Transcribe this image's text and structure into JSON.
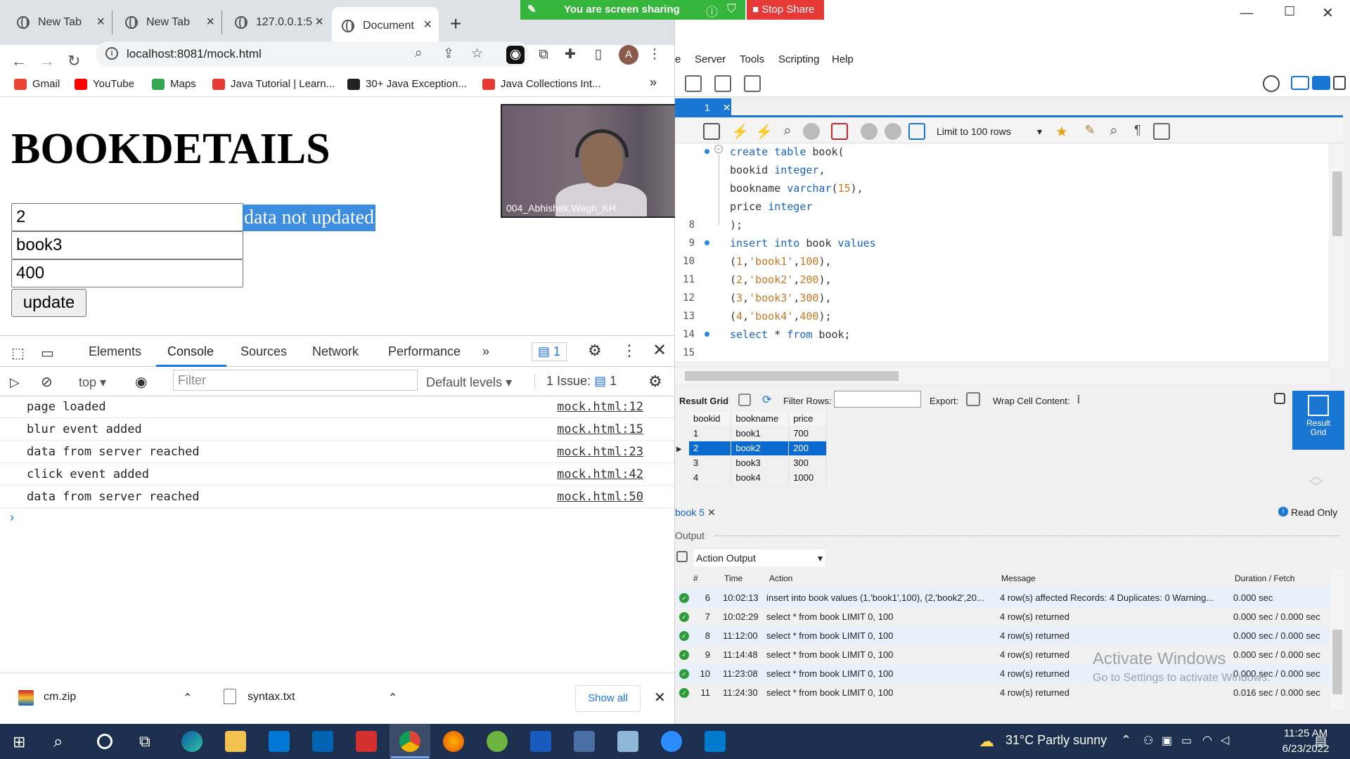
{
  "browser": {
    "tabs": [
      {
        "title": "New Tab"
      },
      {
        "title": "New Tab"
      },
      {
        "title": "127.0.0.1:5"
      },
      {
        "title": "Document"
      }
    ],
    "url": "localhost:8081/mock.html",
    "avatar_letter": "A",
    "bookmarks": [
      {
        "label": "Gmail",
        "color": "#ea4335"
      },
      {
        "label": "YouTube",
        "color": "#ff0000"
      },
      {
        "label": "Maps",
        "color": "#34a853"
      },
      {
        "label": "Java Tutorial | Learn...",
        "color": "#e53935"
      },
      {
        "label": "30+ Java Exception...",
        "color": "#222222"
      },
      {
        "label": "Java Collections Int...",
        "color": "#e53935"
      }
    ],
    "more_bookmarks": "»"
  },
  "page": {
    "heading": "BOOKDETAILS",
    "field_id": "2",
    "field_name": "book3",
    "field_price": "400",
    "message": "data not updated",
    "update_label": "update"
  },
  "video": {
    "name": "004_Abhishek Wagh_KH"
  },
  "devtools": {
    "tabs": [
      "Elements",
      "Console",
      "Sources",
      "Network",
      "Performance"
    ],
    "more": "»",
    "msg_count": "1",
    "context": "top",
    "filter_placeholder": "Filter",
    "levels": "Default levels",
    "issues": "1 Issue:",
    "issues_count": "1",
    "logs": [
      {
        "text": "page loaded",
        "src": "mock.html:12"
      },
      {
        "text": "blur event added",
        "src": "mock.html:15"
      },
      {
        "text": "data from server reached",
        "src": "mock.html:23"
      },
      {
        "text": "click event added",
        "src": "mock.html:42"
      },
      {
        "text": "data from server reached",
        "src": "mock.html:50"
      }
    ],
    "prompt": "›"
  },
  "downloads": {
    "items": [
      {
        "name": "cm.zip"
      },
      {
        "name": "syntax.txt"
      }
    ],
    "show_all": "Show all"
  },
  "share": {
    "status": "You are screen sharing",
    "stop": "Stop Share"
  },
  "workbench": {
    "menu": [
      "e",
      "Server",
      "Tools",
      "Scripting",
      "Help"
    ],
    "sql_tab": "1",
    "limit": "Limit to 100 rows",
    "code_lines": [
      {
        "ln": "",
        "dot": true
      },
      {
        "ln": ""
      },
      {
        "ln": ""
      },
      {
        "ln": ""
      },
      {
        "ln": "8"
      },
      {
        "ln": "9",
        "dot": true
      },
      {
        "ln": "10"
      },
      {
        "ln": "11"
      },
      {
        "ln": "12"
      },
      {
        "ln": "13"
      },
      {
        "ln": "14",
        "dot": true
      },
      {
        "ln": "15"
      }
    ],
    "result_bar": {
      "result_grid": "Result Grid",
      "filter_rows": "Filter Rows:",
      "export": "Export:",
      "wrap": "Wrap Cell Content:",
      "side": "Result Grid"
    },
    "grid": {
      "headers": [
        "bookid",
        "bookname",
        "price"
      ],
      "rows": [
        [
          "1",
          "book1",
          "700"
        ],
        [
          "2",
          "book2",
          "200"
        ],
        [
          "3",
          "book3",
          "300"
        ],
        [
          "4",
          "book4",
          "1000"
        ]
      ],
      "selected_row": 1
    },
    "result_tab": "book 5",
    "read_only": "Read Only",
    "output_label": "Output",
    "action_output": "Action Output",
    "output_headers": [
      "#",
      "Time",
      "Action",
      "Message",
      "Duration / Fetch"
    ],
    "output_rows": [
      {
        "n": "6",
        "time": "10:02:13",
        "action": "insert into book values (1,'book1',100), (2,'book2',20...",
        "message": "4 row(s) affected Records: 4  Duplicates: 0  Warning...",
        "duration": "0.000 sec"
      },
      {
        "n": "7",
        "time": "10:02:29",
        "action": "select * from book LIMIT 0, 100",
        "message": "4 row(s) returned",
        "duration": "0.000 sec / 0.000 sec"
      },
      {
        "n": "8",
        "time": "11:12:00",
        "action": "select * from book LIMIT 0, 100",
        "message": "4 row(s) returned",
        "duration": "0.000 sec / 0.000 sec"
      },
      {
        "n": "9",
        "time": "11:14:48",
        "action": "select * from book LIMIT 0, 100",
        "message": "4 row(s) returned",
        "duration": "0.000 sec / 0.000 sec"
      },
      {
        "n": "10",
        "time": "11:23:08",
        "action": "select * from book LIMIT 0, 100",
        "message": "4 row(s) returned",
        "duration": "0.000 sec / 0.000 sec"
      },
      {
        "n": "11",
        "time": "11:24:30",
        "action": "select * from book LIMIT 0, 100",
        "message": "4 row(s) returned",
        "duration": "0.016 sec / 0.000 sec"
      }
    ],
    "watermark_title": "Activate Windows",
    "watermark_sub": "Go to Settings to activate Windows."
  },
  "taskbar": {
    "weather": "31°C  Partly sunny",
    "time": "11:25 AM",
    "date": "6/23/2022"
  }
}
